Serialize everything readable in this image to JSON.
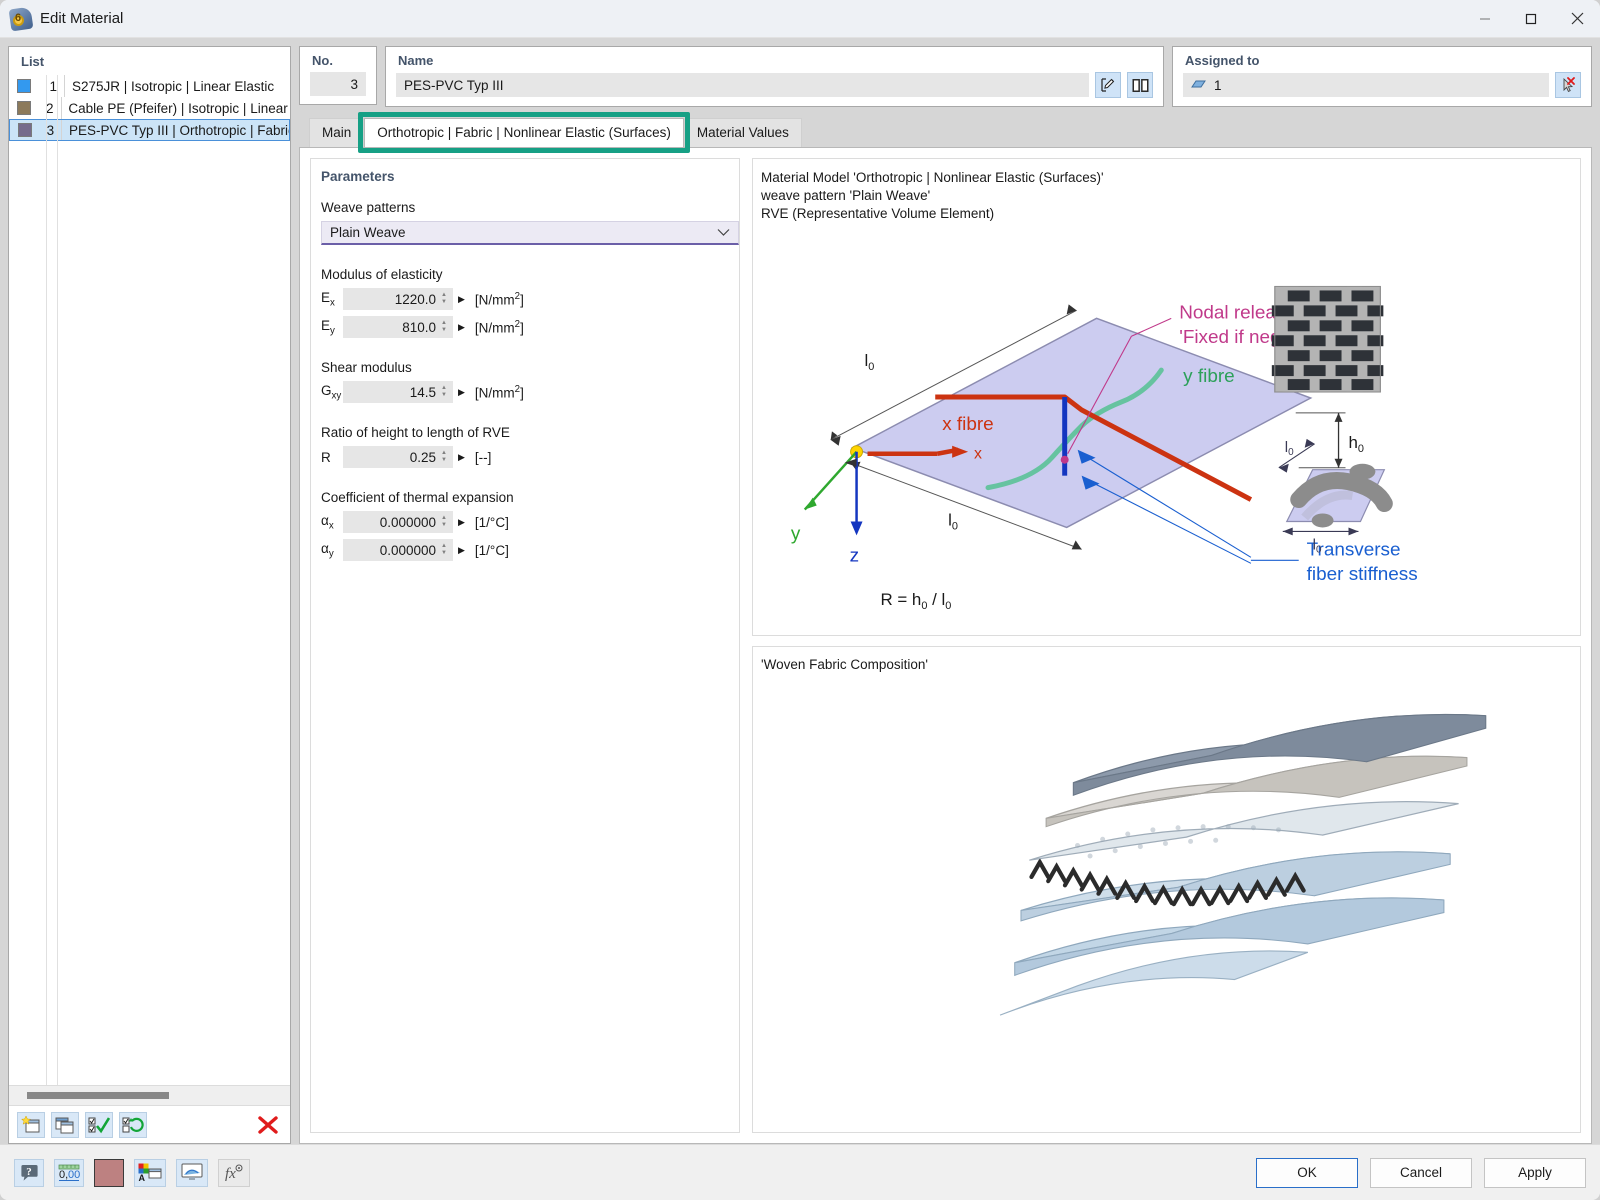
{
  "window": {
    "title": "Edit Material",
    "icon": "material-tag-icon",
    "controls": {
      "minimize": "—",
      "maximize": "☐",
      "close": "✕"
    }
  },
  "list_panel": {
    "header": "List",
    "items": [
      {
        "no": "1",
        "label": "S275JR | Isotropic | Linear Elastic",
        "color": "#3399ef",
        "selected": false
      },
      {
        "no": "2",
        "label": "Cable PE (Pfeifer) | Isotropic | Linear Elasti",
        "color": "#8c7a5b",
        "selected": false
      },
      {
        "no": "3",
        "label": "PES-PVC Typ III | Orthotropic | Fabric | Nor",
        "color": "#766b8c",
        "selected": true
      }
    ],
    "toolbar": [
      {
        "name": "new-material-button",
        "icon": "new-window-star-icon"
      },
      {
        "name": "copy-material-button",
        "icon": "copy-windows-icon"
      },
      {
        "name": "select-all-button",
        "icon": "checkbox-check-icon"
      },
      {
        "name": "invert-selection-button",
        "icon": "checkbox-swap-icon"
      },
      {
        "name": "delete-material-button",
        "icon": "red-x-icon"
      }
    ]
  },
  "no_box": {
    "header": "No.",
    "value": "3"
  },
  "name_box": {
    "header": "Name",
    "value": "PES-PVC Typ III",
    "buttons": [
      {
        "name": "edit-name-button",
        "icon": "pencil-edit-icon"
      },
      {
        "name": "material-library-button",
        "icon": "book-library-icon"
      }
    ]
  },
  "assigned_box": {
    "header": "Assigned to",
    "value": "1",
    "value_icon": "surface-icon",
    "deselect_button": {
      "name": "deselect-button",
      "icon": "cursor-red-x-icon"
    }
  },
  "tabs": [
    {
      "label": "Main",
      "active": false
    },
    {
      "label": "Orthotropic | Fabric | Nonlinear Elastic (Surfaces)",
      "active": true
    },
    {
      "label": "Material Values",
      "active": false
    }
  ],
  "highlight_color": "#16a085",
  "parameters": {
    "section_title": "Parameters",
    "weave_label": "Weave patterns",
    "weave_value": "Plain Weave",
    "groups": [
      {
        "label": "Modulus of elasticity",
        "rows": [
          {
            "sym": "E",
            "subsym": "x",
            "value": "1220.0",
            "unit_prefix": "[N/mm",
            "unit_sup": "2",
            "unit_suffix": "]"
          },
          {
            "sym": "E",
            "subsym": "y",
            "value": "810.0",
            "unit_prefix": "[N/mm",
            "unit_sup": "2",
            "unit_suffix": "]"
          }
        ]
      },
      {
        "label": "Shear modulus",
        "rows": [
          {
            "sym": "G",
            "subsym": "xy",
            "value": "14.5",
            "unit_prefix": "[N/mm",
            "unit_sup": "2",
            "unit_suffix": "]"
          }
        ]
      },
      {
        "label": "Ratio of height to length of RVE",
        "rows": [
          {
            "sym": "R",
            "subsym": "",
            "value": "0.25",
            "unit_prefix": "[--]",
            "unit_sup": "",
            "unit_suffix": ""
          }
        ]
      },
      {
        "label": "Coefficient of thermal expansion",
        "rows": [
          {
            "sym": "α",
            "subsym": "x",
            "value": "0.000000",
            "unit_prefix": "[1/°C]",
            "unit_sup": "",
            "unit_suffix": ""
          },
          {
            "sym": "α",
            "subsym": "y",
            "value": "0.000000",
            "unit_prefix": "[1/°C]",
            "unit_sup": "",
            "unit_suffix": ""
          }
        ]
      }
    ]
  },
  "model_panel": {
    "line1": "Material Model 'Orthotropic | Nonlinear Elastic (Surfaces)'",
    "line2": "weave pattern 'Plain Weave'",
    "line3": "RVE (Representative Volume Element)",
    "diagram_labels": {
      "nodal_release_1": "Nodal release",
      "nodal_release_2": "ʹFixed if negative Nʹ",
      "x_fibre": "x fibre",
      "y_fibre": "y fibre",
      "transverse_1": "Transverse",
      "transverse_2": "fiber stiffness",
      "axis_x": "x",
      "axis_y": "y",
      "axis_z": "z",
      "l0": "l",
      "l0_sub": "0",
      "h0": "h",
      "h0_sub": "0",
      "formula": "R = h0 / l0"
    },
    "diagram_colors": {
      "x_fibre": "#cc3311",
      "y_fibre": "#3cb371",
      "nodal": "#c0398a",
      "transverse": "#1a5fd0",
      "surface": "#ccccf0",
      "axis_z": "#1a3fd0"
    }
  },
  "fabric_panel": {
    "caption": "'Woven Fabric Composition'"
  },
  "bottom_toolbar": [
    {
      "name": "help-button",
      "icon": "question-balloon-icon"
    },
    {
      "name": "units-button",
      "icon": "decimal-places-icon"
    },
    {
      "name": "color-button",
      "icon": "color-swatch-icon",
      "color": "#bd8181"
    },
    {
      "name": "display-properties-button",
      "icon": "color-font-icon"
    },
    {
      "name": "render-button",
      "icon": "monitor-icon"
    },
    {
      "name": "formula-button",
      "icon": "fx-icon"
    }
  ],
  "dialog_buttons": [
    {
      "label": "OK",
      "name": "ok-button",
      "primary": true
    },
    {
      "label": "Cancel",
      "name": "cancel-button",
      "primary": false
    },
    {
      "label": "Apply",
      "name": "apply-button",
      "primary": false
    }
  ]
}
